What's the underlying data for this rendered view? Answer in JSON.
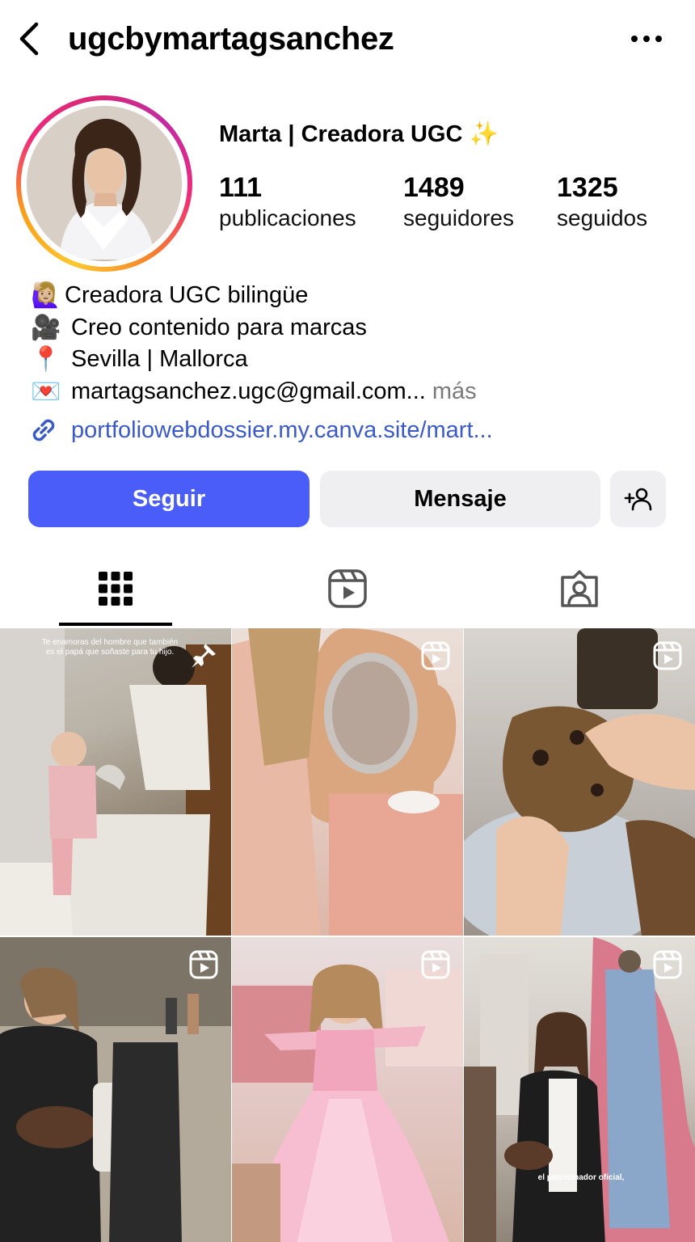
{
  "header": {
    "username": "ugcbymartagsanchez",
    "back_icon": "chevron-left-icon",
    "more_icon": "ellipsis-icon"
  },
  "profile": {
    "display_name": "Marta | Creadora UGC",
    "display_name_emoji": "✨",
    "stats": [
      {
        "value": "111",
        "label": "publicaciones"
      },
      {
        "value": "1489",
        "label": "seguidores"
      },
      {
        "value": "1325",
        "label": "seguidos"
      }
    ]
  },
  "bio": {
    "lines": [
      {
        "emoji": "🙋🏼‍♀️",
        "text": "Creadora UGC bilingüe"
      },
      {
        "emoji": "🎥",
        "text": "Creo contenido para marcas"
      },
      {
        "emoji": "📍",
        "text": "Sevilla | Mallorca"
      },
      {
        "emoji": "💌",
        "text": "martagsanchez.ugc@gmail.com..."
      }
    ],
    "more_label": "más",
    "link": "portfoliowebdossier.my.canva.site/mart..."
  },
  "actions": {
    "follow_label": "Seguir",
    "message_label": "Mensaje"
  },
  "tabs": [
    {
      "icon": "grid-icon",
      "active": true
    },
    {
      "icon": "reels-icon",
      "active": false
    },
    {
      "icon": "tagged-icon",
      "active": false
    }
  ],
  "grid": {
    "posts": [
      {
        "badge": "pin-icon",
        "caption": "Te enamoras del hombre que también es el papá que soñaste para tu hijo."
      },
      {
        "badge": "reel-icon",
        "caption": ""
      },
      {
        "badge": "reel-icon",
        "caption": ""
      },
      {
        "badge": "reel-icon",
        "caption": ""
      },
      {
        "badge": "reel-icon",
        "caption": ""
      },
      {
        "badge": "reel-icon",
        "caption": "el patrocinador oficial,"
      }
    ]
  },
  "colors": {
    "follow_button": "#4a5df9",
    "link": "#3b5ac8",
    "secondary_button": "#efeff1"
  }
}
